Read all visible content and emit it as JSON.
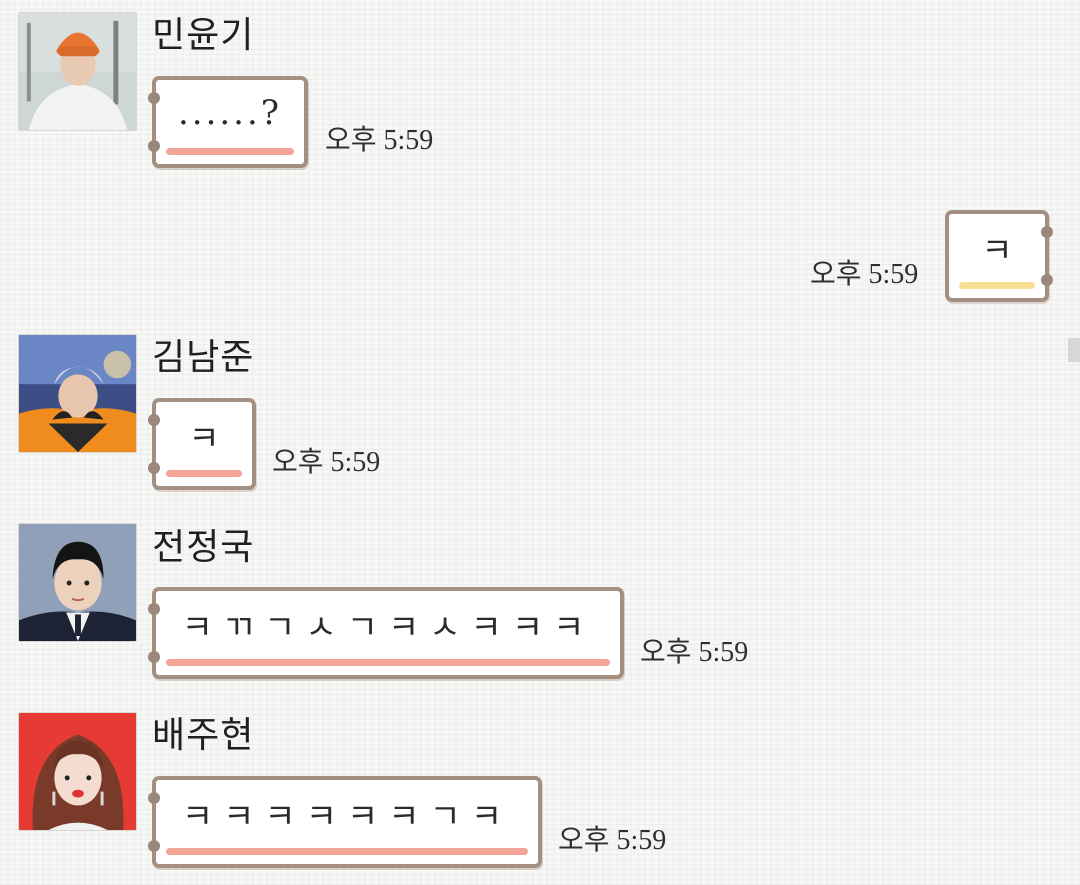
{
  "time_label": "오후 5:59",
  "messages": [
    {
      "sender": "민윤기",
      "avatar_icon": "orange-beanie-avatar",
      "text": "......?",
      "time": "오후 5:59",
      "direction": "incoming"
    },
    {
      "sender": "",
      "text": "ㅋ",
      "time": "오후 5:59",
      "direction": "outgoing"
    },
    {
      "sender": "김남준",
      "avatar_icon": "orange-jacket-avatar",
      "text": "ㅋ",
      "time": "오후 5:59",
      "direction": "incoming"
    },
    {
      "sender": "전정국",
      "avatar_icon": "suit-avatar",
      "text": "ㅋㄲㄱㅅㄱㅋㅅㅋㅋㅋ",
      "time": "오후 5:59",
      "direction": "incoming"
    },
    {
      "sender": "배주현",
      "avatar_icon": "red-background-avatar",
      "text": "ㅋㅋㅋㅋㅋㅋㄱㅋ",
      "time": "오후 5:59",
      "direction": "incoming"
    }
  ],
  "colors": {
    "incoming_underline": "#f2a497",
    "outgoing_underline": "#f7de94",
    "bubble_border": "#a58f80"
  }
}
